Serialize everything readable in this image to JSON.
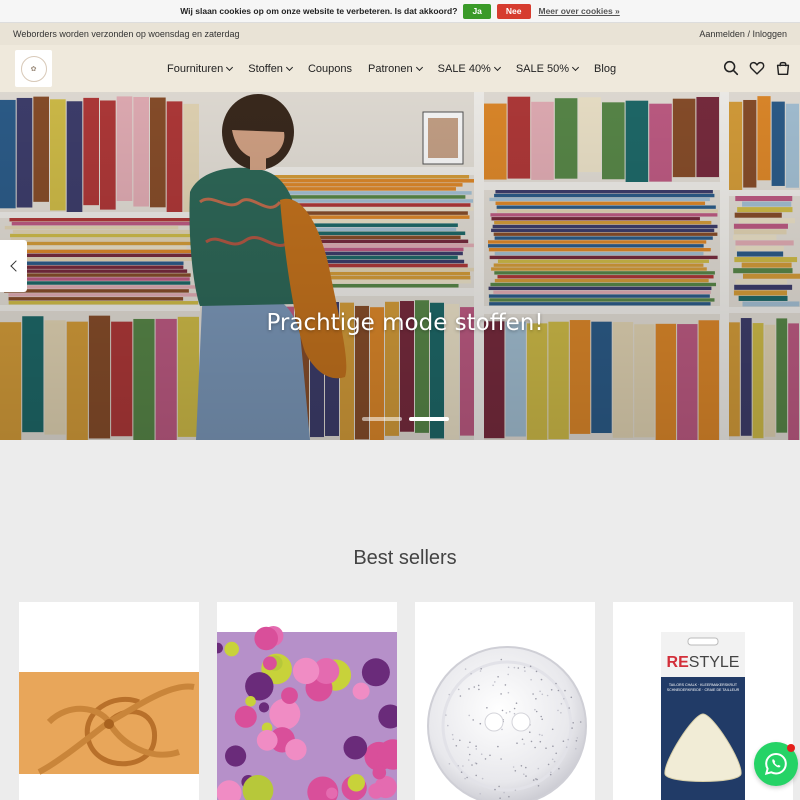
{
  "cookie": {
    "message": "Wij slaan cookies op om onze website te verbeteren. Is dat akkoord?",
    "accept_label": "Ja",
    "decline_label": "Nee",
    "more_label": "Meer over cookies »"
  },
  "topbar": {
    "notice": "Weborders worden verzonden op woensdag en zaterdag",
    "login_label": "Aanmelden",
    "separator": " / ",
    "register_label": "Inloggen"
  },
  "nav": {
    "items": [
      {
        "label": "Fournituren",
        "dropdown": true
      },
      {
        "label": "Stoffen",
        "dropdown": true
      },
      {
        "label": "Coupons",
        "dropdown": false
      },
      {
        "label": "Patronen",
        "dropdown": true
      },
      {
        "label": "SALE 40%",
        "dropdown": true
      },
      {
        "label": "SALE 50%",
        "dropdown": true
      },
      {
        "label": "Blog",
        "dropdown": false
      }
    ],
    "icons": [
      "search-icon",
      "heart-icon",
      "cart-icon"
    ]
  },
  "hero": {
    "caption": "Prachtige mode stoffen!",
    "slide_count": 2,
    "active_slide": 2
  },
  "best_sellers": {
    "title": "Best sellers",
    "products": [
      {
        "image": "orange-swirl-fabric"
      },
      {
        "image": "pink-floral-fabric"
      },
      {
        "image": "glitter-button"
      },
      {
        "image": "restyle-tailor-chalk"
      }
    ],
    "chalk_brand": "RESTYLE",
    "chalk_text": "TAILORS CHALK · KLEERMAKERSKRIJT · SCHNEIDERKREIDE · CRAIE DE TAILLEUR"
  },
  "colors": {
    "accent_green": "#3a9a28",
    "decline_red": "#d63c2f",
    "header_bg": "#efe9dc",
    "whatsapp": "#25d366"
  }
}
